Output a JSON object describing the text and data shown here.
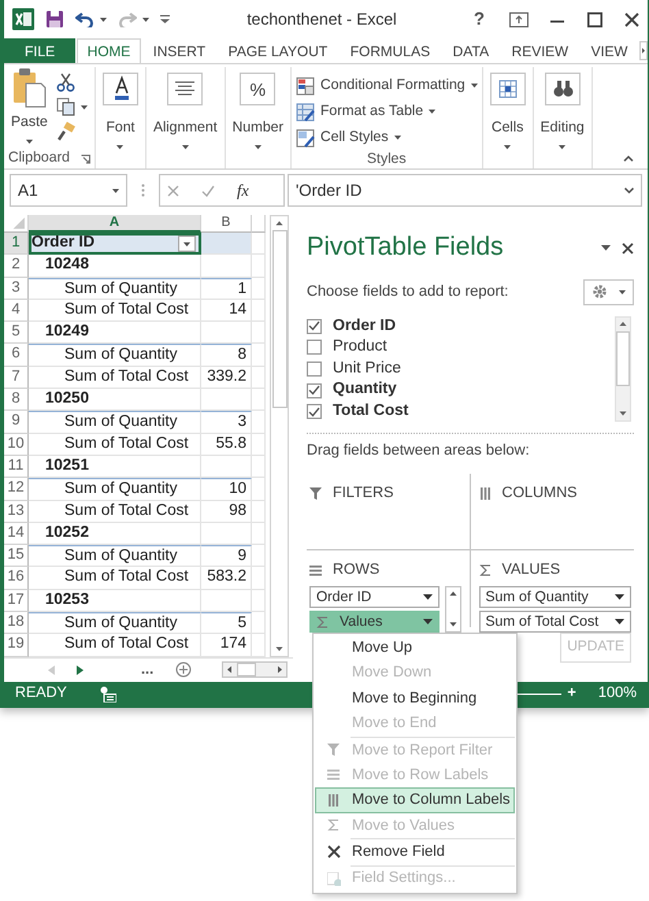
{
  "window": {
    "title": "techonthenet - Excel",
    "help": "?"
  },
  "ribbon_tabs": [
    {
      "label": "FILE",
      "kind": "file",
      "selected": false
    },
    {
      "label": "HOME",
      "kind": "tab",
      "selected": true
    },
    {
      "label": "INSERT",
      "kind": "tab",
      "selected": false
    },
    {
      "label": "PAGE LAYOUT",
      "kind": "tab",
      "selected": false
    },
    {
      "label": "FORMULAS",
      "kind": "tab",
      "selected": false
    },
    {
      "label": "DATA",
      "kind": "tab",
      "selected": false
    },
    {
      "label": "REVIEW",
      "kind": "tab",
      "selected": false
    },
    {
      "label": "VIEW",
      "kind": "tab",
      "selected": false
    }
  ],
  "ribbon_groups": [
    {
      "label": "Clipboard",
      "commands": [
        {
          "label": "Paste",
          "kind": "paste"
        }
      ]
    },
    {
      "commands": [
        {
          "label": "Font",
          "kind": "font"
        }
      ]
    },
    {
      "commands": [
        {
          "label": "Alignment",
          "kind": "alignment"
        }
      ]
    },
    {
      "commands": [
        {
          "label": "Number",
          "kind": "number",
          "glyph": "%"
        }
      ]
    },
    {
      "label": "Styles",
      "commands": [
        {
          "label": "Conditional Formatting",
          "kind": "conditional"
        },
        {
          "label": "Format as Table",
          "kind": "table"
        },
        {
          "label": "Cell Styles",
          "kind": "styles"
        }
      ]
    },
    {
      "commands": [
        {
          "label": "Cells",
          "kind": "cells"
        }
      ]
    },
    {
      "commands": [
        {
          "label": "Editing",
          "kind": "editing"
        }
      ]
    }
  ],
  "formula_bar": {
    "name_box": "A1",
    "function_button": "fx",
    "formula": "'Order ID"
  },
  "sheet": {
    "columns": [
      {
        "label": "A",
        "selected": true
      },
      {
        "label": "B",
        "selected": false
      }
    ],
    "rows": [
      {
        "number": "1",
        "kind": "header",
        "a": "Order ID",
        "selected": true
      },
      {
        "number": "2",
        "kind": "order",
        "a": "10248",
        "selected": false
      },
      {
        "number": "3",
        "kind": "measure",
        "a": "Sum of Quantity",
        "b": "1",
        "selected": false
      },
      {
        "number": "4",
        "kind": "measure",
        "a": "Sum of Total Cost",
        "b": "14",
        "selected": false
      },
      {
        "number": "5",
        "kind": "order",
        "a": "10249",
        "selected": false
      },
      {
        "number": "6",
        "kind": "measure",
        "a": "Sum of Quantity",
        "b": "8",
        "selected": false
      },
      {
        "number": "7",
        "kind": "measure",
        "a": "Sum of Total Cost",
        "b": "339.2",
        "selected": false
      },
      {
        "number": "8",
        "kind": "order",
        "a": "10250",
        "selected": false
      },
      {
        "number": "9",
        "kind": "measure",
        "a": "Sum of Quantity",
        "b": "3",
        "selected": false
      },
      {
        "number": "10",
        "kind": "measure",
        "a": "Sum of Total Cost",
        "b": "55.8",
        "selected": false
      },
      {
        "number": "11",
        "kind": "order",
        "a": "10251",
        "selected": false
      },
      {
        "number": "12",
        "kind": "measure",
        "a": "Sum of Quantity",
        "b": "10",
        "selected": false
      },
      {
        "number": "13",
        "kind": "measure",
        "a": "Sum of Total Cost",
        "b": "98",
        "selected": false
      },
      {
        "number": "14",
        "kind": "order",
        "a": "10252",
        "selected": false
      },
      {
        "number": "15",
        "kind": "measure",
        "a": "Sum of Quantity",
        "b": "9",
        "selected": false
      },
      {
        "number": "16",
        "kind": "measure",
        "a": "Sum of Total Cost",
        "b": "583.2",
        "selected": false
      },
      {
        "number": "17",
        "kind": "order",
        "a": "10253",
        "selected": false
      },
      {
        "number": "18",
        "kind": "measure",
        "a": "Sum of Quantity",
        "b": "5",
        "selected": false
      },
      {
        "number": "19",
        "kind": "measure",
        "a": "Sum of Total Cost",
        "b": "174",
        "selected": false
      }
    ]
  },
  "sheet_nav": {
    "more": "..."
  },
  "status_bar": {
    "mode": "READY",
    "zoom_in": "+",
    "zoom": "100%"
  },
  "pivot_pane": {
    "title": "PivotTable Fields",
    "prompt": "Choose fields to add to report:",
    "fields": [
      {
        "label": "Order ID",
        "checked": true
      },
      {
        "label": "Product",
        "checked": false
      },
      {
        "label": "Unit Price",
        "checked": false
      },
      {
        "label": "Quantity",
        "checked": true
      },
      {
        "label": "Total Cost",
        "checked": true
      }
    ],
    "areas_hint": "Drag fields between areas below:",
    "areas": [
      {
        "label": "FILTERS",
        "kind": "filters"
      },
      {
        "label": "COLUMNS",
        "kind": "columns"
      },
      {
        "label": "ROWS",
        "kind": "rows",
        "items": [
          {
            "label": "Order ID",
            "kind": "field",
            "selected": false
          },
          {
            "label": "Values",
            "kind": "values",
            "selected": true
          }
        ]
      },
      {
        "label": "VALUES",
        "kind": "values",
        "items": [
          {
            "label": "Sum of Quantity",
            "kind": "field",
            "selected": false
          },
          {
            "label": "Sum of Total Cost",
            "kind": "field",
            "selected": false
          }
        ]
      }
    ],
    "update_button": {
      "label": "UPDATE",
      "disabled": true
    }
  },
  "context_menu": {
    "items": [
      {
        "label": "Move Up",
        "kind": "plain",
        "disabled": false,
        "selected": false,
        "separator_before": false
      },
      {
        "label": "Move Down",
        "kind": "plain",
        "disabled": true,
        "selected": false,
        "separator_before": false
      },
      {
        "label": "Move to Beginning",
        "kind": "plain",
        "disabled": false,
        "selected": false,
        "separator_before": false
      },
      {
        "label": "Move to End",
        "kind": "plain",
        "disabled": true,
        "selected": false,
        "separator_before": false
      },
      {
        "label": "Move to Report Filter",
        "kind": "filters",
        "disabled": true,
        "selected": false,
        "separator_before": true
      },
      {
        "label": "Move to Row Labels",
        "kind": "rows",
        "disabled": true,
        "selected": false,
        "separator_before": false
      },
      {
        "label": "Move to Column Labels",
        "kind": "columns",
        "disabled": false,
        "selected": true,
        "separator_before": false
      },
      {
        "label": "Move to Values",
        "kind": "values",
        "disabled": true,
        "selected": false,
        "separator_before": false
      },
      {
        "label": "Remove Field",
        "kind": "remove",
        "disabled": false,
        "selected": false,
        "separator_before": true
      },
      {
        "label": "Field Settings...",
        "kind": "settings",
        "disabled": true,
        "selected": false,
        "separator_before": true
      }
    ]
  }
}
